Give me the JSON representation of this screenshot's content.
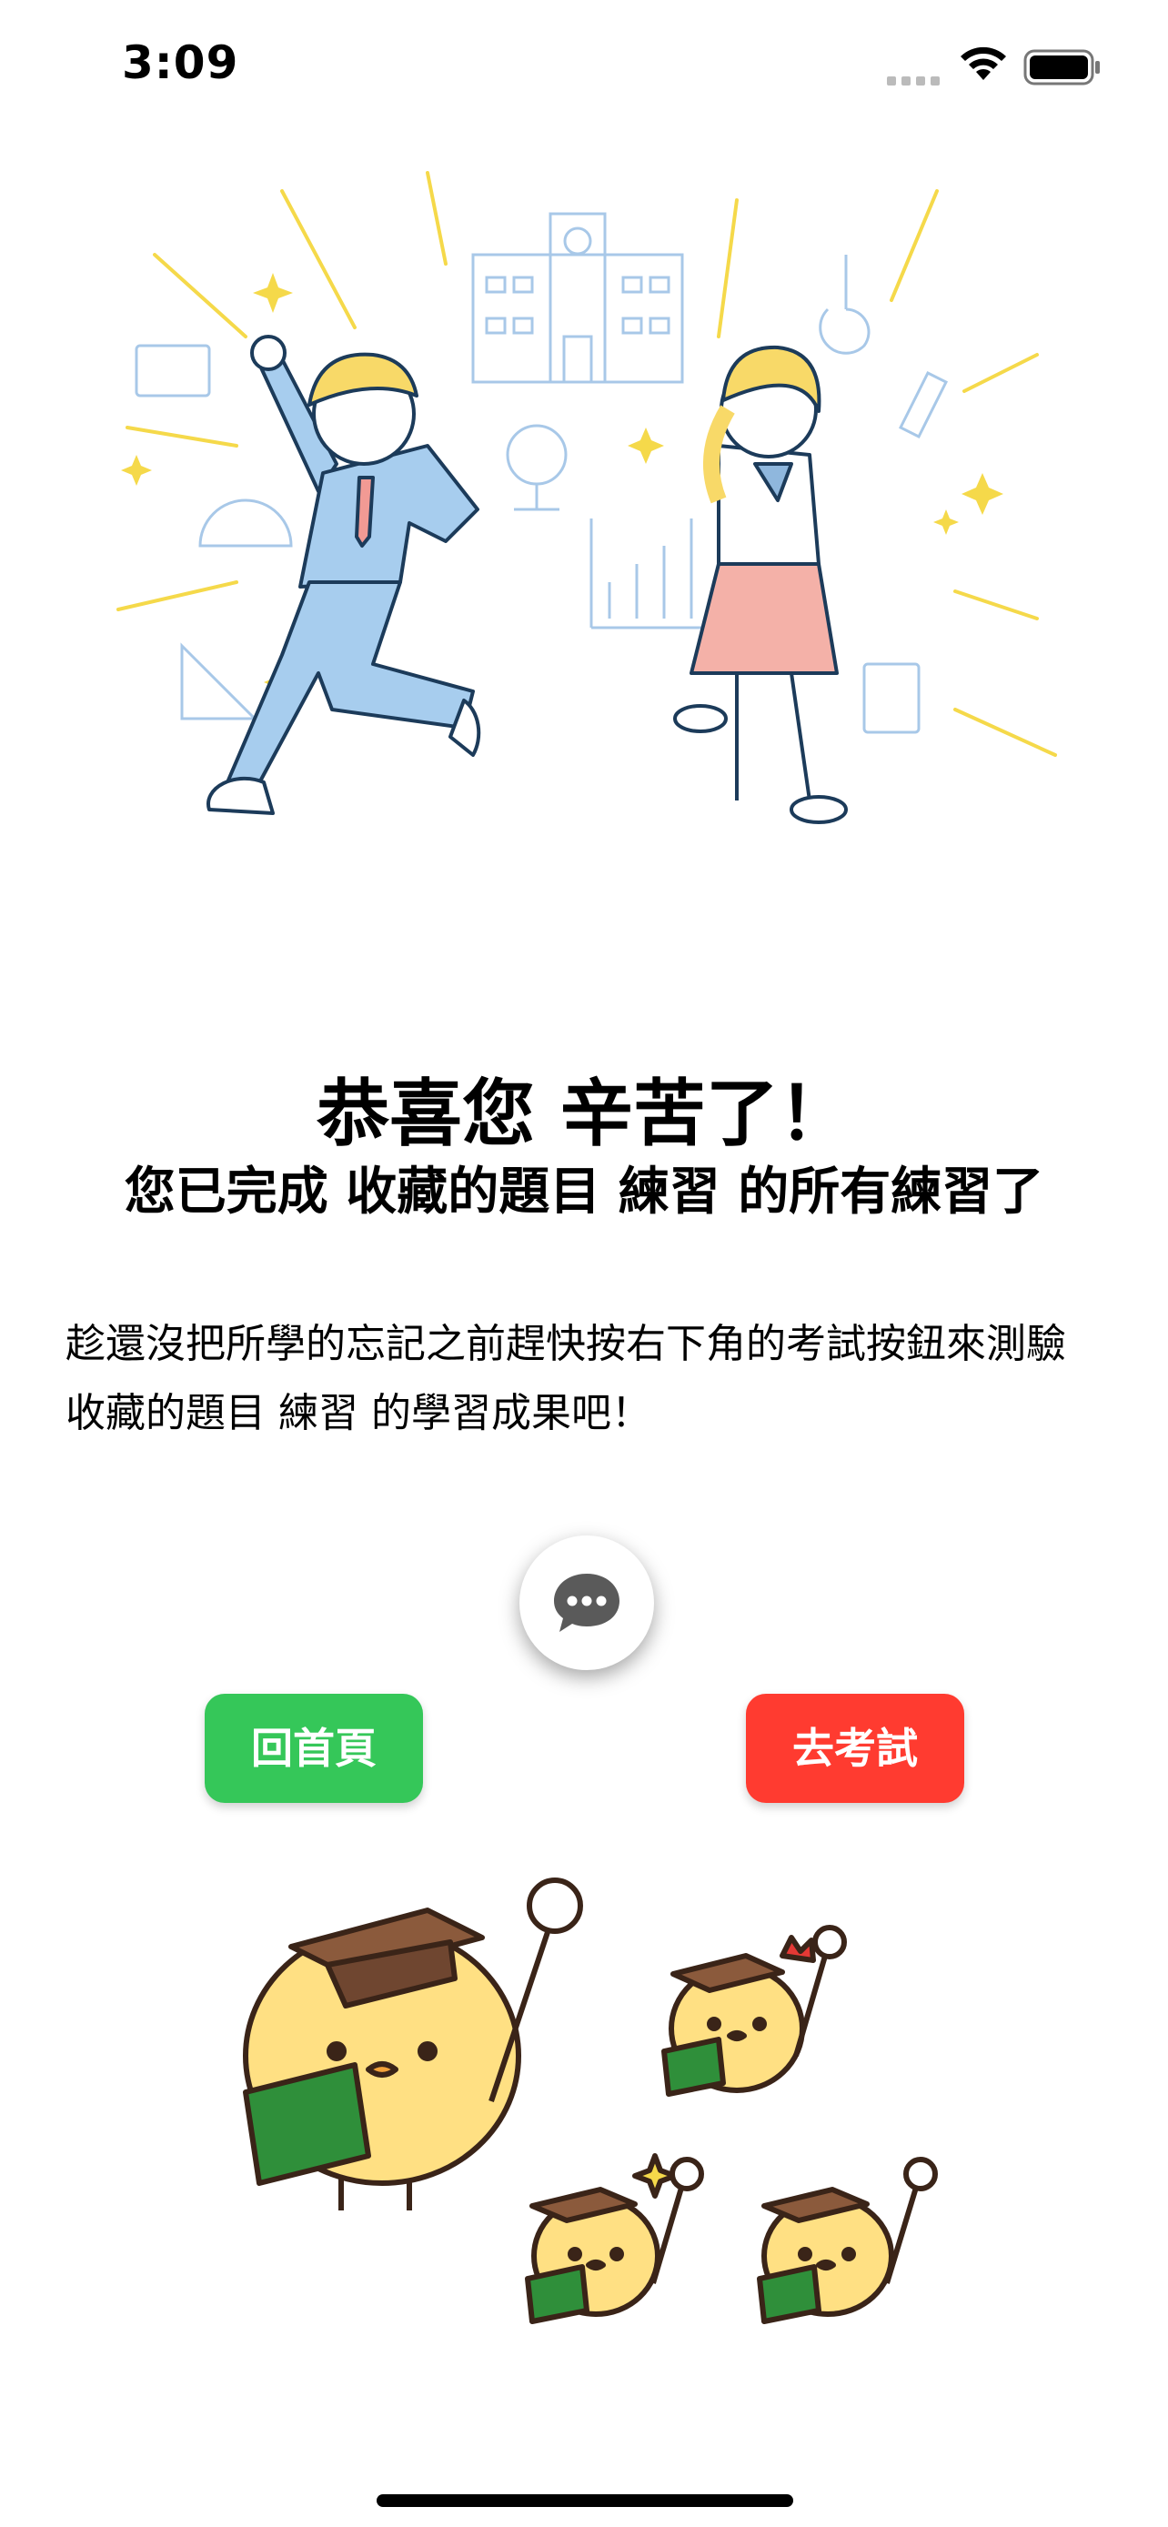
{
  "status_bar": {
    "time": "3:09",
    "signal_icon": "cellular-signal-icon",
    "wifi_icon": "wifi-icon",
    "battery_icon": "battery-icon"
  },
  "hero": {
    "illustration": "celebrating-students-illustration"
  },
  "result": {
    "title": "恭喜您 辛苦了！",
    "subtitle": "您已完成 收藏的題目 練習 的所有練習了",
    "message": "趁還沒把所學的忘記之前趕快按右下角的考試按鈕來測驗 收藏的題目 練習 的學習成果吧！"
  },
  "fab": {
    "icon": "chat-bubble-icon"
  },
  "actions": {
    "home_label": "回首頁",
    "exam_label": "去考試"
  },
  "footer": {
    "illustration": "graduate-chicks-illustration"
  },
  "colors": {
    "home_button": "#35c759",
    "exam_button": "#ff3b30",
    "chick_yellow": "#ffe083",
    "book_green": "#2f8f3a",
    "cap_brown": "#8b5a3c"
  }
}
